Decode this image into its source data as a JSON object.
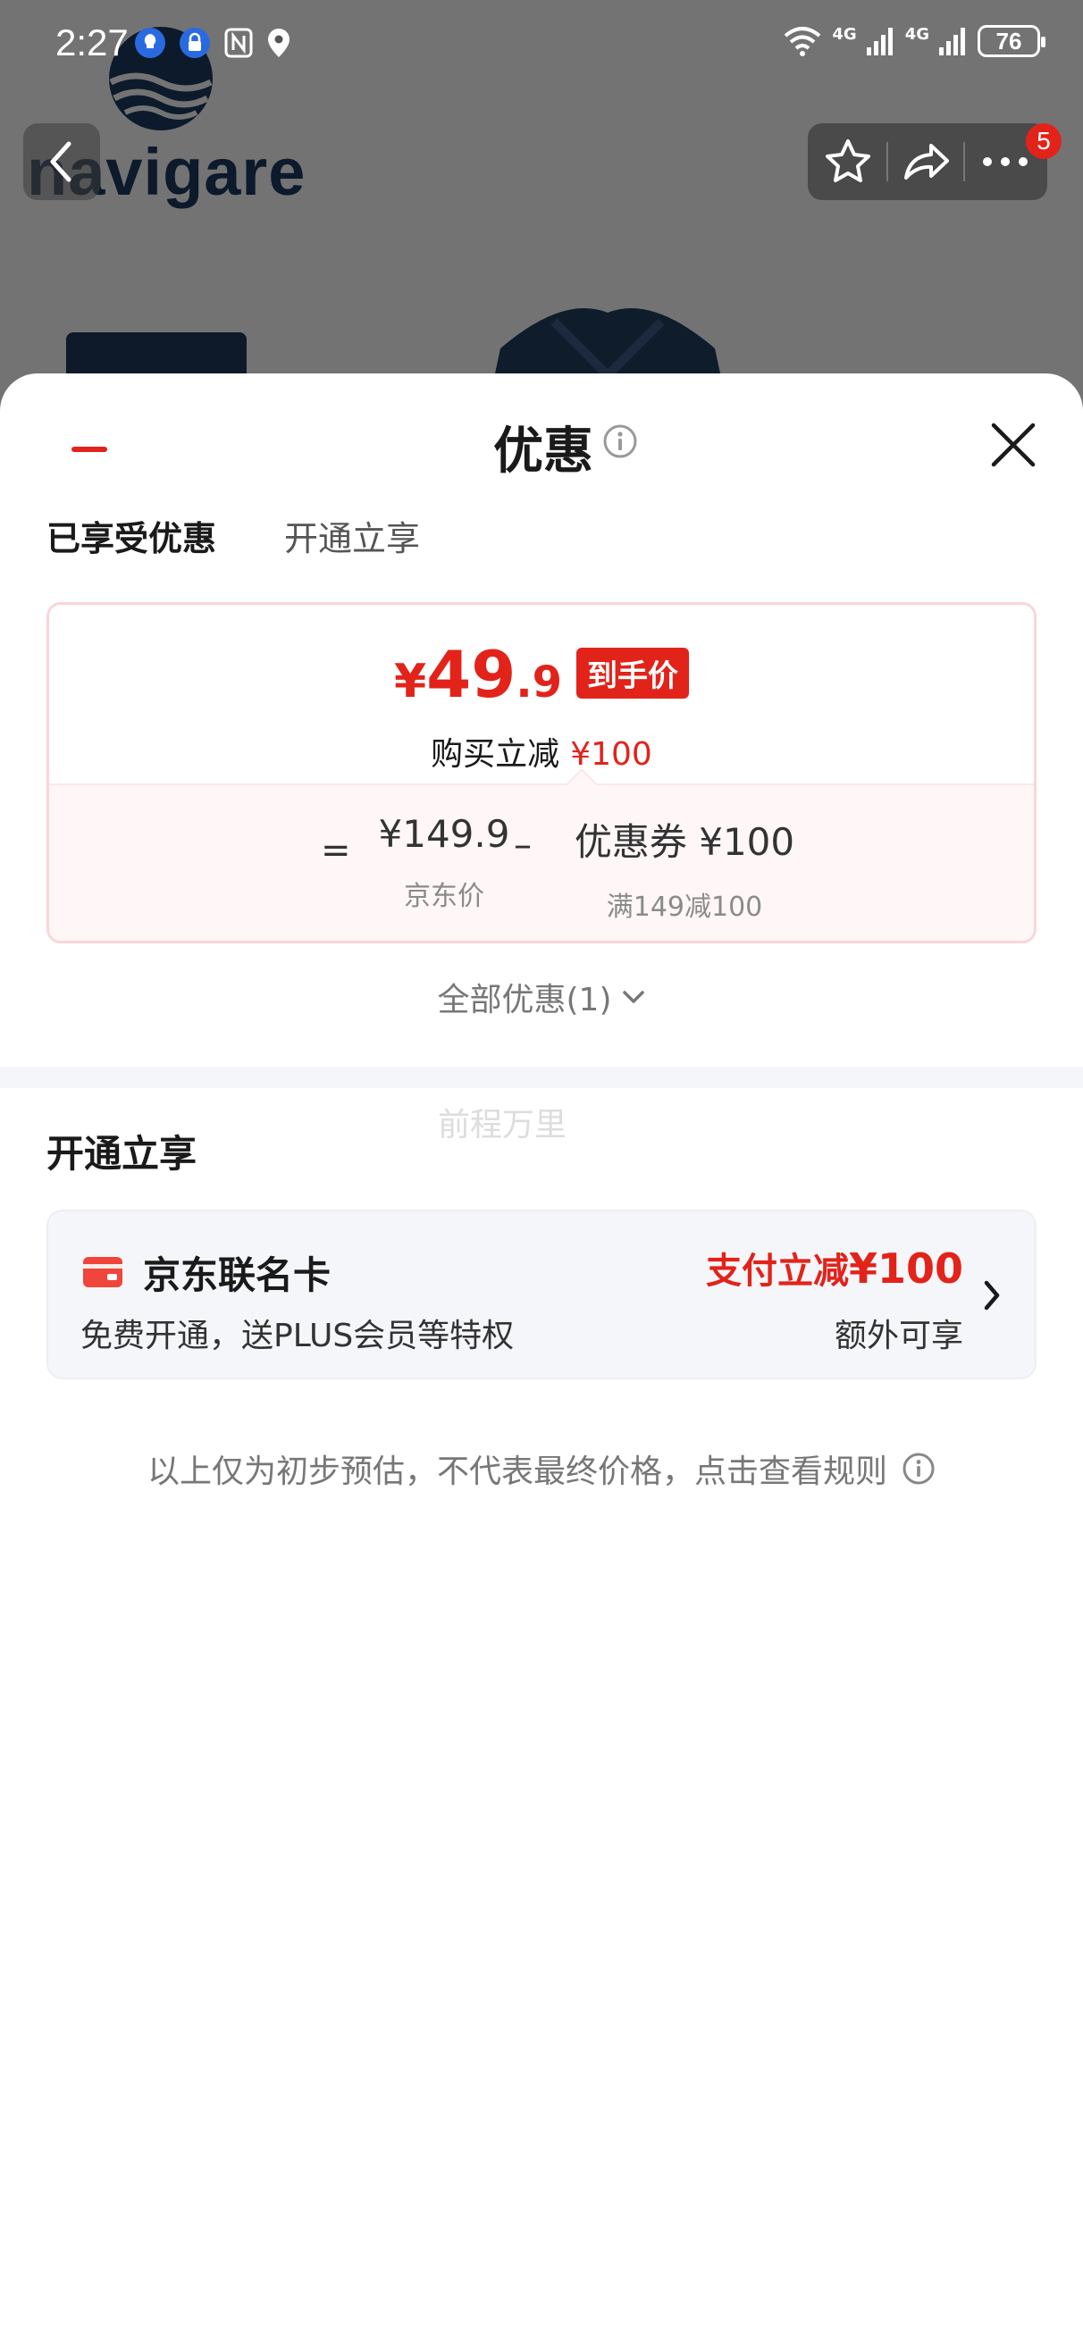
{
  "status_bar": {
    "time": "2:27",
    "network_1": "4G",
    "network_2": "4G",
    "battery": "76"
  },
  "background_page": {
    "brand_logo_text": "navigare",
    "cart_badge_count": "5"
  },
  "sheet": {
    "title": "优惠",
    "tabs": [
      {
        "label": "已享受优惠",
        "active": true
      },
      {
        "label": "开通立享",
        "active": false
      }
    ],
    "price_card": {
      "currency": "¥",
      "final_price_int": "49",
      "final_price_dec": ".9",
      "final_price_tag": "到手价",
      "instant_off_label": "购买立减",
      "instant_off_amount": "¥100",
      "equals_sign": "=",
      "base_price": "¥149.9",
      "base_price_label": "京东价",
      "minus_sign": "–",
      "coupon_value": "优惠券 ¥100",
      "coupon_rule": "满149减100"
    },
    "all_discounts_label": "全部优惠(1)",
    "watermark_text": "前程万里",
    "open_section_title": "开通立享",
    "card_offer": {
      "name": "京东联名卡",
      "description": "免费开通，送PLUS会员等特权",
      "discount_prefix": "支付立减",
      "discount_amount": "¥100",
      "extra_label": "额外可享"
    },
    "disclaimer": "以上仅为初步预估，不代表最终价格，点击查看规则"
  },
  "colors": {
    "accent_red": "#e2231a",
    "card_border_pink": "#f9d6d9",
    "card_bg_gray": "#f5f6fa",
    "brand_navy": "#1b3a63"
  },
  "icons": {
    "title_info": "info-circle-icon",
    "close": "close-icon",
    "expand": "chevron-down-icon",
    "card": "credit-card-icon",
    "card_arrow": "chevron-right-icon",
    "disclaimer_info": "info-circle-icon",
    "back": "chevron-left-icon",
    "favorite": "star-icon",
    "share": "share-icon",
    "more": "more-dots-icon"
  }
}
